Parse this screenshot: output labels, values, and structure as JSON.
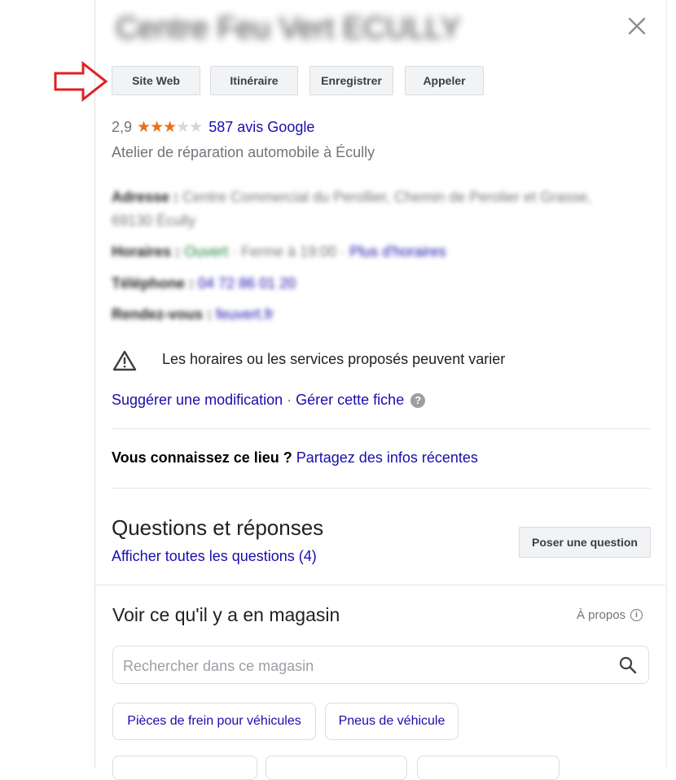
{
  "header": {
    "title": "Centre Feu Vert ECULLY"
  },
  "actions": [
    {
      "label": "Site Web"
    },
    {
      "label": "Itinéraire"
    },
    {
      "label": "Enregistrer"
    },
    {
      "label": "Appeler"
    }
  ],
  "rating": {
    "value": "2,9",
    "stars_filled": 3,
    "stars_total": 5,
    "reviews_link": "587 avis Google"
  },
  "category": "Atelier de réparation automobile à Écully",
  "details": {
    "address_label": "Adresse :",
    "address_value": "Centre Commercial du Perollier, Chemin de Perolier et Grasse,",
    "address_value_2": "69130 Écully",
    "hours_label": "Horaires :",
    "hours_status": "Ouvert",
    "hours_value": "· Ferme à 19:00 ·",
    "hours_link": "Plus d'horaires",
    "phone_label": "Téléphone :",
    "phone_value": "04 72 86 01 20",
    "appointments_label": "Rendez-vous :",
    "appointments_value": "feuvert.fr"
  },
  "notice": "Les horaires ou les services proposés peuvent varier",
  "edit_links": {
    "suggest": "Suggérer une modification",
    "separator": " · ",
    "manage": "Gérer cette fiche",
    "help": "?"
  },
  "know": {
    "question": "Vous connaissez ce lieu ?",
    "link": "Partagez des infos récentes"
  },
  "qa": {
    "title": "Questions et réponses",
    "link": "Afficher toutes les questions (4)",
    "ask_button": "Poser une question"
  },
  "store": {
    "title": "Voir ce qu'il y a en magasin",
    "about": "À propos",
    "search_placeholder": "Rechercher dans ce magasin",
    "chips": [
      {
        "label": "Pièces de frein pour véhicules"
      },
      {
        "label": "Pneus de véhicule"
      }
    ]
  },
  "colors": {
    "link": "#1a0dab",
    "star": "#e7711b",
    "arrow": "#e02020"
  }
}
